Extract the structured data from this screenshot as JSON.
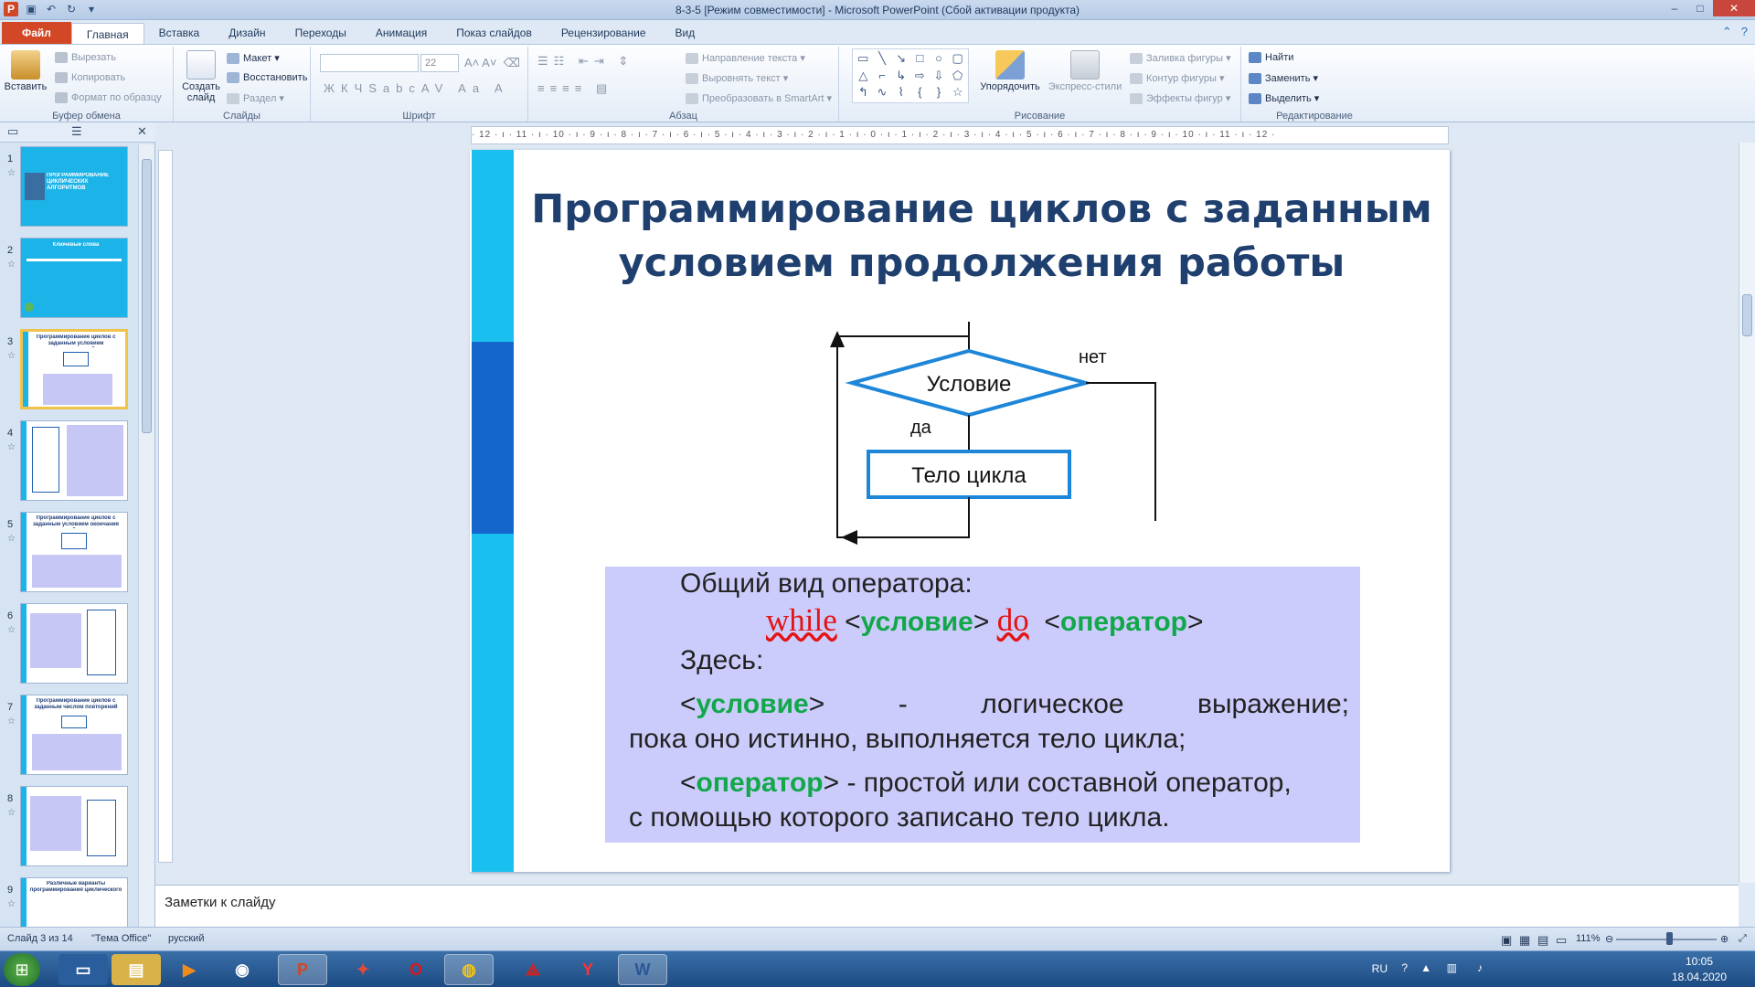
{
  "window": {
    "title": "8-3-5 [Режим совместимости] - Microsoft PowerPoint (Сбой активации продукта)"
  },
  "tabs": [
    "Файл",
    "Главная",
    "Вставка",
    "Дизайн",
    "Переходы",
    "Анимация",
    "Показ слайдов",
    "Рецензирование",
    "Вид"
  ],
  "ribbon": {
    "clipboard": {
      "paste": "Вставить",
      "cut": "Вырезать",
      "copy": "Копировать",
      "format": "Формат по образцу",
      "label": "Буфер обмена"
    },
    "slides": {
      "new": "Создать слайд",
      "layout": "Макет",
      "reset": "Восстановить",
      "section": "Раздел",
      "label": "Слайды"
    },
    "font": {
      "size": "22",
      "label": "Шрифт"
    },
    "paragraph": {
      "direction": "Направление текста",
      "align": "Выровнять текст",
      "smartart": "Преобразовать в SmartArt",
      "label": "Абзац"
    },
    "drawing": {
      "arrange": "Упорядочить",
      "styles": "Экспресс-стили",
      "fill": "Заливка фигуры",
      "outline": "Контур фигуры",
      "effects": "Эффекты фигур",
      "label": "Рисование"
    },
    "editing": {
      "find": "Найти",
      "replace": "Заменить",
      "select": "Выделить",
      "label": "Редактирование"
    }
  },
  "thumbnails": [
    {
      "num": "1",
      "title": "ПРОГРАММИРОВАНИЕ ЦИКЛИЧЕСКИХ АЛГОРИТМОВ"
    },
    {
      "num": "2",
      "title": "Ключевые слова"
    },
    {
      "num": "3",
      "title": "Программирование циклов с заданным условием продолжения работы"
    },
    {
      "num": "4",
      "title": ""
    },
    {
      "num": "5",
      "title": "Программирование циклов с заданным условием окончания работы"
    },
    {
      "num": "6",
      "title": ""
    },
    {
      "num": "7",
      "title": "Программирование циклов с заданным числом повторений"
    },
    {
      "num": "8",
      "title": ""
    },
    {
      "num": "9",
      "title": "Различные варианты программирования циклического алгоритма"
    }
  ],
  "ruler": {
    "h": "· 12 · ı · 11 · ı · 10 · ı · 9 · ı · 8 · ı · 7 · ı · 6 · ı · 5 · ı · 4 · ı · 3 · ı · 2 · ı · 1 · ı · 0 · ı · 1 · ı · 2 · ı · 3 · ı · 4 · ı · 5 · ı · 6 · ı · 7 · ı · 8 · ı · 9 · ı · 10 · ı · 11 · ı · 12 ·"
  },
  "slide": {
    "title": "Программирование циклов с заданным условием продолжения работы",
    "flowchart": {
      "condition": "Условие",
      "body": "Тело цикла",
      "yes": "да",
      "no": "нет"
    },
    "code": {
      "general": "Общий вид оператора:",
      "kw_while": "while",
      "cond": "условие",
      "kw_do": "do",
      "op": "оператор",
      "here": "Здесь:",
      "cond_desc_1": "-",
      "cond_desc_2": "логическое",
      "cond_desc_3": "выражение;",
      "cond_desc_line2": "пока оно истинно, выполняется тело цикла;",
      "op_desc": "- простой или составной оператор,",
      "op_desc_line2": "с помощью которого записано тело цикла."
    }
  },
  "notes": {
    "placeholder": "Заметки к слайду"
  },
  "status": {
    "slide": "Слайд 3 из 14",
    "theme": "\"Тема Office\"",
    "lang": "русский",
    "zoom": "111%"
  },
  "taskbar": {
    "lang": "RU",
    "time": "10:05",
    "date": "18.04.2020"
  }
}
